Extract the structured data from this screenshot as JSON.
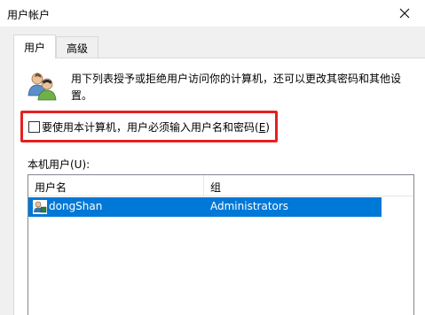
{
  "window": {
    "title": "用户帐户"
  },
  "tabs": [
    {
      "label": "用户"
    },
    {
      "label": "高级"
    }
  ],
  "panel": {
    "description": "用下列表授予或拒绝用户访问你的计算机，还可以更改其密码和其他设置。",
    "checkbox": {
      "label_prefix": "要使用本计算机，用户必须输入用户名和密码(",
      "accelerator": "E",
      "label_suffix": ")",
      "checked": false
    },
    "local_users_label": "本机用户(U):",
    "list": {
      "columns": [
        "用户名",
        "组"
      ],
      "rows": [
        {
          "name": "dongShan",
          "group": "Administrators",
          "selected": true
        }
      ]
    }
  },
  "colors": {
    "selection": "#0078d7",
    "highlight_box": "#e52020",
    "dialog_bg": "#f0f0f0"
  }
}
